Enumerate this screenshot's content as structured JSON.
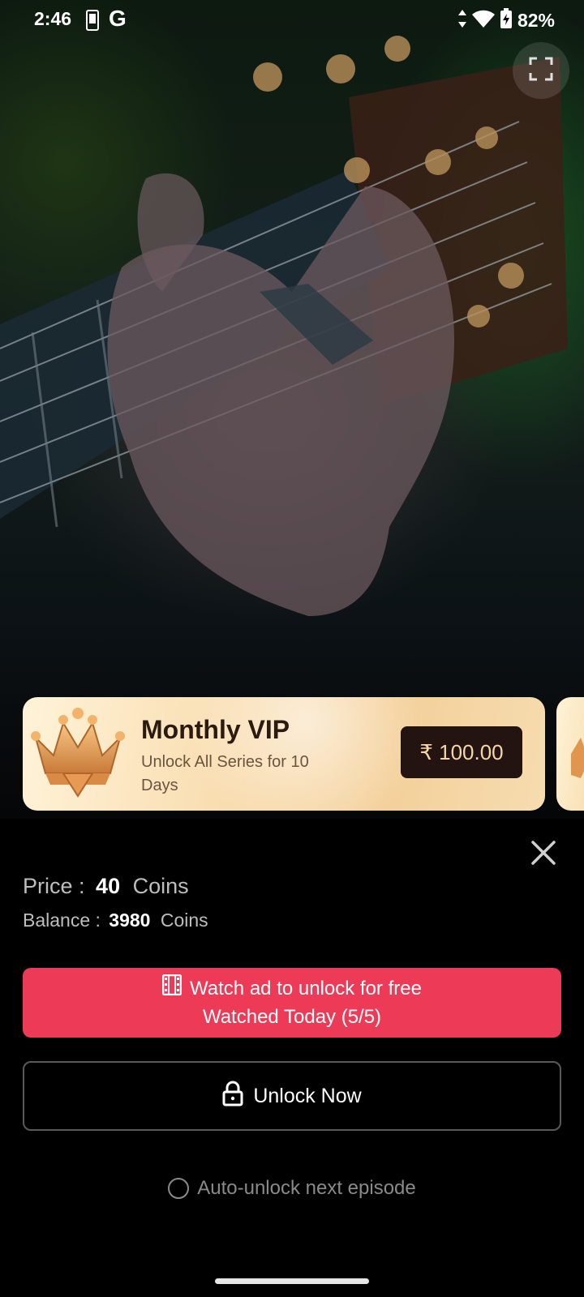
{
  "status_bar": {
    "time": "2:46",
    "carrier_glyph": "G",
    "battery_percent": "82%",
    "icons": [
      "phone-icon",
      "data-arrows-icon",
      "wifi-icon",
      "battery-charging-icon"
    ]
  },
  "video": {
    "fullscreen_icon": "fullscreen-icon"
  },
  "vip_offer": {
    "title": "Monthly VIP",
    "subtitle": "Unlock All Series for 10 Days",
    "price": "₹ 100.00",
    "icon": "crown-icon"
  },
  "unlock_sheet": {
    "price_label": "Price :",
    "price_value": "40",
    "price_unit": "Coins",
    "balance_label": "Balance :",
    "balance_value": "3980",
    "balance_unit": "Coins",
    "watch_ad_label": "Watch ad  to unlock for free",
    "watched_today": "Watched Today  (5/5)",
    "unlock_now_label": "Unlock Now",
    "auto_unlock_label": "Auto-unlock next episode",
    "auto_unlock_checked": false
  },
  "colors": {
    "accent": "#ec3a57",
    "vip_button": "#231412",
    "vip_button_text": "#f6d7a3",
    "sheet_bg": "#000000"
  }
}
